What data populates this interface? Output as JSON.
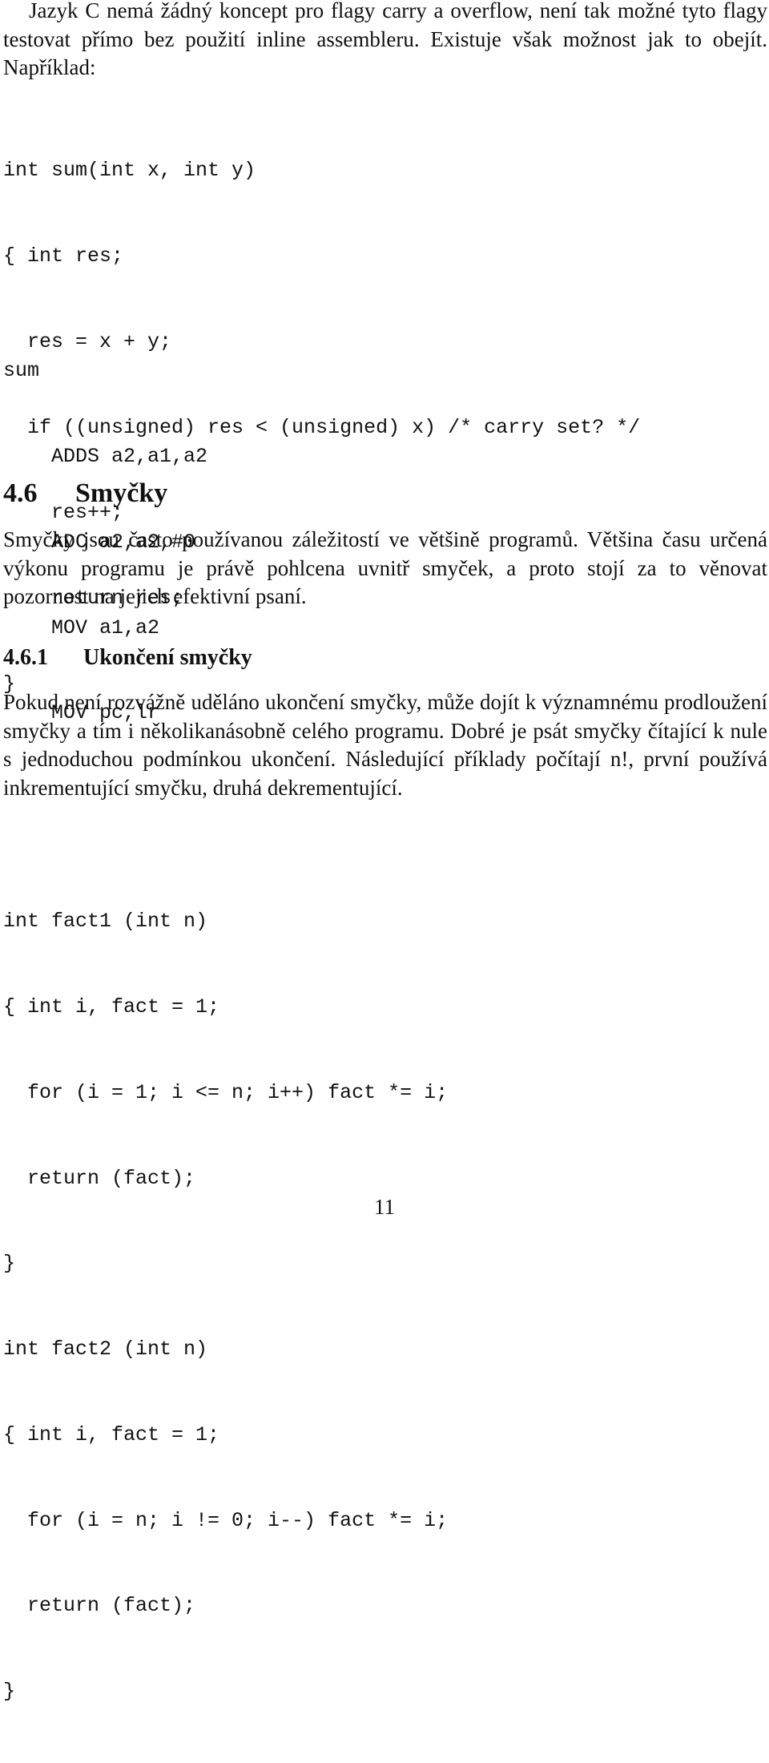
{
  "intro_paragraph": "Jazyk C nemá žádný koncept pro flagy carry a overflow, není tak možné tyto flagy testovat přímo bez použití inline assembleru. Existuje však možnost jak to obejít. Například:",
  "code_sum_c": [
    "int sum(int x, int y)",
    "{ int res;",
    "  res = x + y;",
    "  if ((unsigned) res < (unsigned) x) /* carry set? */",
    "    res++;",
    "    return res;",
    "}"
  ],
  "code_sum_asm": [
    "sum",
    "    ADDS a2,a1,a2",
    "    ADC a2,a2,#0",
    "    MOV a1,a2",
    "    MOV pc,lr"
  ],
  "section": {
    "number": "4.6",
    "title": "Smyčky",
    "paragraph": "Smyčky jsou často používanou záležitostí ve většině programů. Většina času určená výkonu programu je právě pohlcena uvnitř smyček, a proto stojí za to věnovat pozornost na jejich efektivní psaní."
  },
  "subsection": {
    "number": "4.6.1",
    "title": "Ukončení smyčky",
    "paragraph": "Pokud není rozvážně uděláno ukončení smyčky, může dojít k významnému prodloužení smyčky a tím i několikanásobně celého programu. Dobré je psát smyčky čítající k nule s jednoduchou podmínkou ukončení. Následující příklady počítají n!, první používá inkrementující smyčku, druhá dekrementující."
  },
  "code_fact": [
    "int fact1 (int n)",
    "{ int i, fact = 1;",
    "  for (i = 1; i <= n; i++) fact *= i;",
    "  return (fact);",
    "}",
    "int fact2 (int n)",
    "{ int i, fact = 1;",
    "  for (i = n; i != 0; i--) fact *= i;",
    "  return (fact);",
    "}"
  ],
  "page_number": "11"
}
